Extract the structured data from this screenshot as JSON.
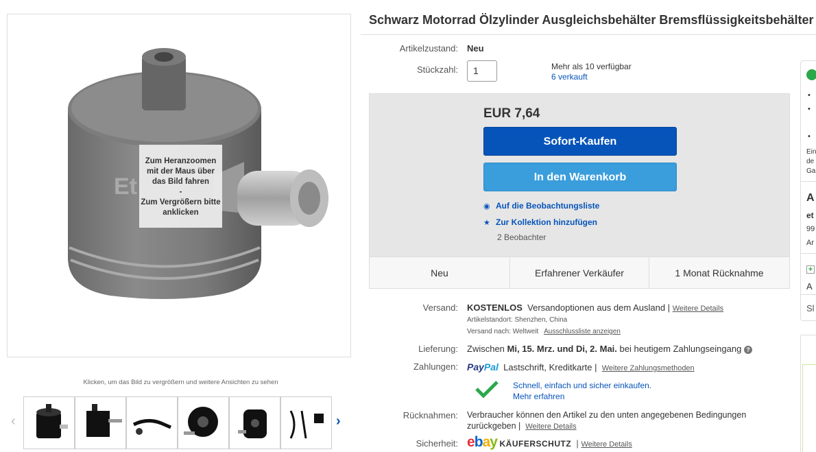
{
  "gallery": {
    "zoom_hint": "Zum Heranzoomen mit der Maus über das Bild fahren - Zum Vergrößern bitte anklicken",
    "hint": "Klicken, um das Bild zu vergrößern und weitere Ansichten zu sehen",
    "watermark": "Et"
  },
  "title": "Schwarz Motorrad Ölzylinder Ausgleichsbehälter Bremsflüssigkeitsbehälter",
  "condition": {
    "label": "Artikelzustand:",
    "value": "Neu"
  },
  "quantity": {
    "label": "Stückzahl:",
    "value": "1",
    "available": "Mehr als 10 verfügbar",
    "sold": "6 verkauft"
  },
  "buy_box": {
    "price": "EUR 7,64",
    "buy_now": "Sofort-Kaufen",
    "add_to_cart": "In den Warenkorb",
    "watchlist": "Auf die Beobachtungsliste",
    "collection": "Zur Kollektion hinzufügen",
    "watchers": "2 Beobachter",
    "badges": [
      "Neu",
      "Erfahrener Verkäufer",
      "1 Monat Rücknahme"
    ]
  },
  "shipping": {
    "label": "Versand:",
    "cost": "KOSTENLOS",
    "text": "Versandoptionen aus dem Ausland |",
    "details": "Weitere Details",
    "location": "Artikelstandort:  Shenzhen, China",
    "ships_to": "Versand nach:  Weltweit",
    "exclusions": "Ausschlussliste anzeigen"
  },
  "delivery": {
    "label": "Lieferung:",
    "prefix": "Zwischen",
    "dates": "Mi, 15. Mrz. und Di, 2. Mai.",
    "suffix": "bei heutigem Zahlungseingang"
  },
  "payments": {
    "label": "Zahlungen:",
    "paypal": "PayPal",
    "methods": "Lastschrift,  Kreditkarte |",
    "more": "Weitere Zahlungsmethoden",
    "promo": "Schnell, einfach und sicher einkaufen.",
    "learn_more": "Mehr erfahren"
  },
  "returns": {
    "label": "Rücknahmen:",
    "text1": "Verbraucher können den Artikel zu den unten angegebenen Bedingungen",
    "text2": "zurückgeben |",
    "details": "Weitere Details"
  },
  "security": {
    "label": "Sicherheit:",
    "ebay": "ebay",
    "protection": "KÄUFERSCHUTZ",
    "details": "Weitere Details"
  },
  "side": {
    "lines": [
      "Ein",
      "de",
      "Ga",
      "A",
      "et",
      "99",
      "Ar",
      "A",
      "Sl"
    ]
  },
  "colors": {
    "buy_button": "#0654ba",
    "cart_button": "#3a9ddc",
    "link": "#0654ba",
    "check": "#2ba84a"
  }
}
